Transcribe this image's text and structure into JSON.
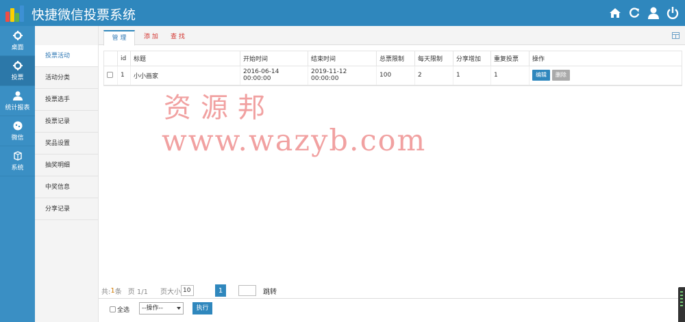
{
  "app": {
    "title": "快捷微信投票系统",
    "logo_colors": [
      "#f04d44",
      "#fcd000",
      "#61b246",
      "#3d90d4"
    ],
    "top_icons": [
      "home-icon",
      "refresh-icon",
      "user-icon",
      "power-icon"
    ]
  },
  "rail": [
    {
      "label": "桌面",
      "icon": "gear-icon"
    },
    {
      "label": "投票",
      "icon": "gear-icon"
    },
    {
      "label": "统计报表",
      "icon": "user-icon"
    },
    {
      "label": "微信",
      "icon": "chat-icon"
    },
    {
      "label": "系统",
      "icon": "box-icon"
    }
  ],
  "submenu": [
    "投票活动",
    "活动分类",
    "投票选手",
    "投票记录",
    "奖品设置",
    "抽奖明细",
    "中奖信息",
    "分享记录"
  ],
  "tabs": [
    "管 理",
    "添 加",
    "查 找"
  ],
  "table": {
    "headers": [
      "id",
      "标题",
      "开始时间",
      "结束时间",
      "总票限制",
      "每天限制",
      "分享增加",
      "重复投票",
      "操作"
    ],
    "rows": [
      {
        "id": "1",
        "title": "小小画家",
        "start": "2016-06-14 00:00:00",
        "end": "2019-11-12 00:00:00",
        "total": "100",
        "daily": "2",
        "share": "1",
        "repeat": "1",
        "edit": "编辑",
        "delete": "删除"
      }
    ]
  },
  "watermark": {
    "line1": "资源邦",
    "line2": "www.wazyb.com"
  },
  "pager": {
    "total_prefix": "共:",
    "total": "1",
    "total_suffix": " 条",
    "page_label": "页 1/1",
    "size_label": "页大小",
    "size": "10",
    "current": "1",
    "jump": "跳转"
  },
  "bottom": {
    "select_all": "全选",
    "action_select": "--操作--",
    "execute": "执行"
  }
}
